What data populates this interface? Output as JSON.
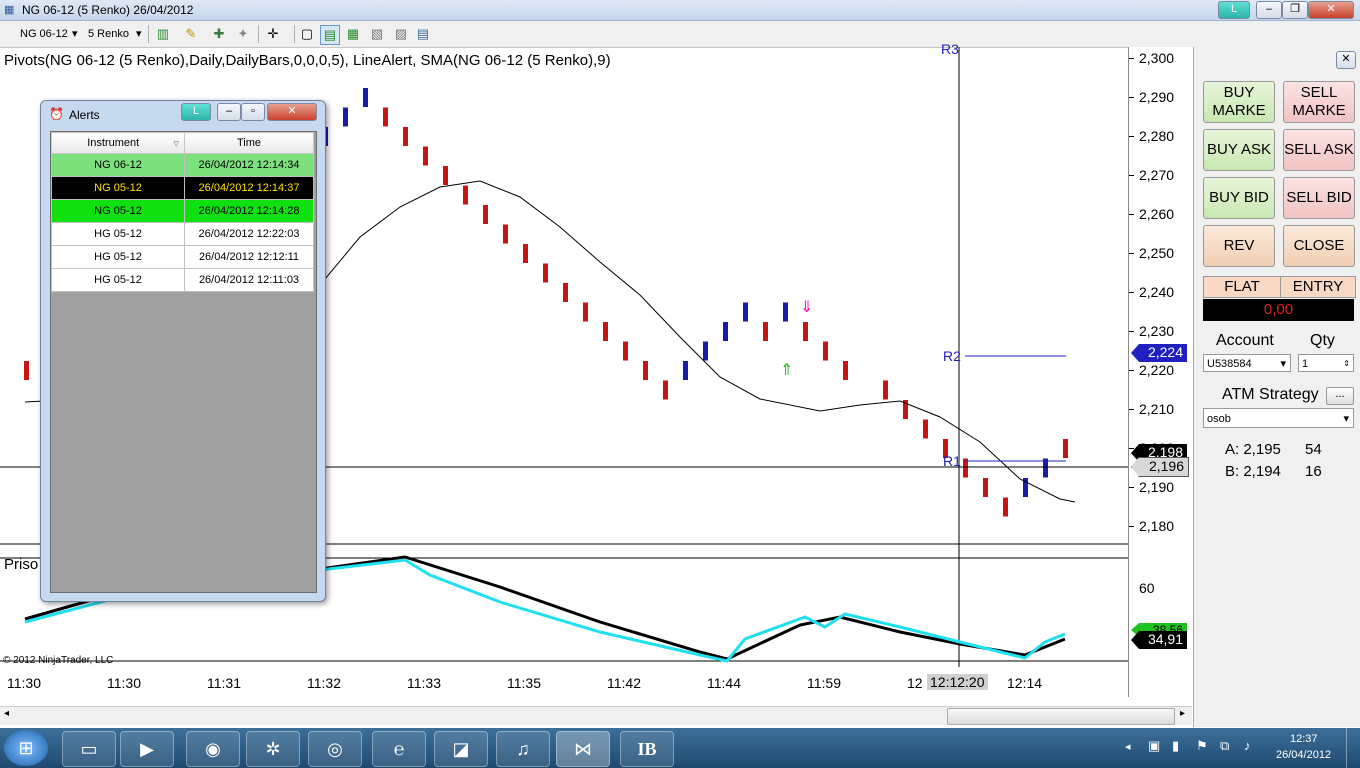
{
  "window": {
    "title": "NG 06-12 (5 Renko)  26/04/2012",
    "l_label": "L"
  },
  "toolbar": {
    "instrument": "NG 06-12",
    "period": "5 Renko"
  },
  "chart": {
    "indicator_label": "Pivots(NG 06-12 (5 Renko),Daily,DailyBars,0,0,0,5), LineAlert, SMA(NG 06-12 (5 Renko),9)",
    "lower_panel_label": "Priso",
    "copyright": "© 2012 NinjaTrader, LLC",
    "pivot_labels": {
      "r3": "R3",
      "r2": "R2",
      "r1": "R1"
    },
    "price_axis": [
      "2,300",
      "2,290",
      "2,280",
      "2,270",
      "2,260",
      "2,250",
      "2,240",
      "2,230",
      "2,220",
      "2,210",
      "2,200",
      "2,190",
      "2,180"
    ],
    "price_tags": {
      "r2": "2,224",
      "sma": "2,198",
      "last": "2,196"
    },
    "lower_axis": {
      "tick": "60",
      "tag_green": "38,56",
      "tag_black": "34,91"
    },
    "time_axis": [
      "11:30",
      "11:30",
      "11:31",
      "11:32",
      "11:33",
      "11:35",
      "11:42",
      "11:44",
      "11:59",
      "12",
      "12:14"
    ],
    "crosshair_time": "12:12:20",
    "colors": {
      "up": "#1a1aa8",
      "down": "#c81414",
      "sma": "#000000",
      "cyan": "#20e0f0"
    },
    "chart_data": {
      "type": "renko",
      "bricks": [
        {
          "dir": "down",
          "value": 2.22
        },
        {
          "dir": "up",
          "value": 2.28
        },
        {
          "dir": "up",
          "value": 2.285
        },
        {
          "dir": "up",
          "value": 2.29
        },
        {
          "dir": "down",
          "value": 2.285
        },
        {
          "dir": "down",
          "value": 2.28
        },
        {
          "dir": "down",
          "value": 2.275
        },
        {
          "dir": "down",
          "value": 2.27
        },
        {
          "dir": "down",
          "value": 2.265
        },
        {
          "dir": "down",
          "value": 2.26
        },
        {
          "dir": "down",
          "value": 2.255
        },
        {
          "dir": "down",
          "value": 2.25
        },
        {
          "dir": "down",
          "value": 2.245
        },
        {
          "dir": "down",
          "value": 2.24
        },
        {
          "dir": "down",
          "value": 2.235
        },
        {
          "dir": "down",
          "value": 2.23
        },
        {
          "dir": "down",
          "value": 2.225
        },
        {
          "dir": "down",
          "value": 2.22
        },
        {
          "dir": "down",
          "value": 2.215
        },
        {
          "dir": "up",
          "value": 2.22
        },
        {
          "dir": "up",
          "value": 2.225
        },
        {
          "dir": "up",
          "value": 2.23
        },
        {
          "dir": "up",
          "value": 2.235
        },
        {
          "dir": "down",
          "value": 2.23
        },
        {
          "dir": "up",
          "value": 2.235
        },
        {
          "dir": "down",
          "value": 2.23
        },
        {
          "dir": "down",
          "value": 2.225
        },
        {
          "dir": "down",
          "value": 2.22
        },
        {
          "dir": "down",
          "value": 2.215
        },
        {
          "dir": "down",
          "value": 2.21
        },
        {
          "dir": "down",
          "value": 2.205
        },
        {
          "dir": "down",
          "value": 2.2
        },
        {
          "dir": "down",
          "value": 2.195
        },
        {
          "dir": "down",
          "value": 2.19
        },
        {
          "dir": "down",
          "value": 2.185
        },
        {
          "dir": "up",
          "value": 2.19
        },
        {
          "dir": "up",
          "value": 2.195
        },
        {
          "dir": "down",
          "value": 2.2
        }
      ]
    }
  },
  "alerts": {
    "title": "Alerts",
    "l_label": "L",
    "columns": [
      "Instrument",
      "Time"
    ],
    "rows": [
      {
        "instrument": "NG 06-12",
        "time": "26/04/2012 12:14:34",
        "style": "lightgreen"
      },
      {
        "instrument": "NG 05-12",
        "time": "26/04/2012 12:14:37",
        "style": "black"
      },
      {
        "instrument": "NG 05-12",
        "time": "26/04/2012 12:14:28",
        "style": "green"
      },
      {
        "instrument": "HG 05-12",
        "time": "26/04/2012 12:22:03",
        "style": "white"
      },
      {
        "instrument": "HG 05-12",
        "time": "26/04/2012 12:12:11",
        "style": "white"
      },
      {
        "instrument": "HG 05-12",
        "time": "26/04/2012 12:11:03",
        "style": "white"
      }
    ]
  },
  "panel": {
    "buy_market": "BUY MARKE",
    "sell_market": "SELL MARKE",
    "buy_ask": "BUY ASK",
    "sell_ask": "SELL ASK",
    "buy_bid": "BUY BID",
    "sell_bid": "SELL BID",
    "rev": "REV",
    "close": "CLOSE",
    "flat": "FLAT",
    "entry": "ENTRY",
    "pnl": "0,00",
    "account_label": "Account",
    "qty_label": "Qty",
    "account_value": "U538584",
    "qty_value": "1",
    "atm_label": "ATM Strategy",
    "atm_btn": "...",
    "atm_value": "osob",
    "ask": "A: 2,195",
    "ask_size": "54",
    "bid": "B: 2,194",
    "bid_size": "16"
  },
  "taskbar": {
    "time": "12:37",
    "date": "26/04/2012",
    "ib_label": "IB"
  }
}
